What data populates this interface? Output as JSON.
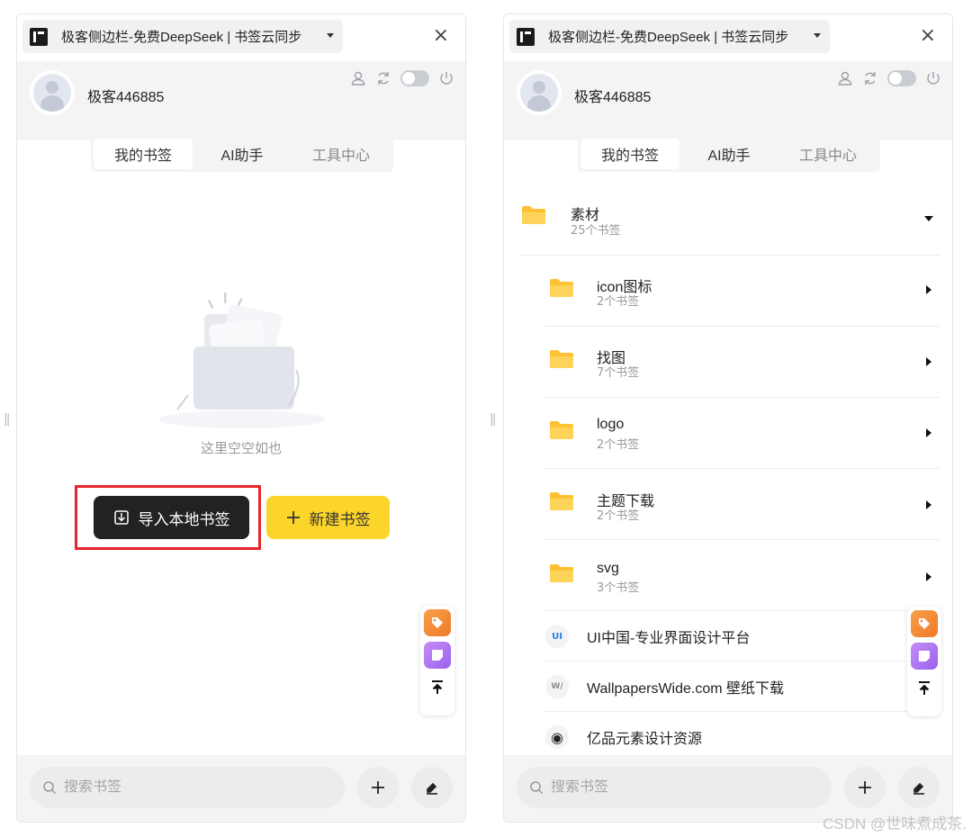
{
  "left_panel": {
    "tab_title": "极客侧边栏-免费DeepSeek | 书签云同步",
    "close_glyph": "×",
    "username": "极客446885",
    "segments": [
      {
        "label": "我的书签"
      },
      {
        "label": "AI助手"
      },
      {
        "label": "工具中心"
      }
    ],
    "empty_text": "这里空空如也",
    "import_label": "导入本地书签",
    "new_label": "新建书签",
    "search_placeholder": "搜索书签",
    "icons": [
      "user-icon",
      "sync-icon",
      "theme-toggle",
      "power-icon",
      "tag-icon",
      "note-icon",
      "back-to-top-icon",
      "plus-icon",
      "edit-icon",
      "search-icon"
    ]
  },
  "right_panel": {
    "tab_title": "极客侧边栏-免费DeepSeek | 书签云同步",
    "close_glyph": "×",
    "username": "极客446885",
    "segments": [
      {
        "label": "我的书签"
      },
      {
        "label": "AI助手"
      },
      {
        "label": "工具中心"
      }
    ],
    "root_folder": {
      "name": "素材",
      "count": "25个书签"
    },
    "subfolders": [
      {
        "name": "icon图标",
        "count": "2个书签"
      },
      {
        "name": "找图",
        "count": "7个书签"
      },
      {
        "name": "logo",
        "count": "2个书签"
      },
      {
        "name": "主题下载",
        "count": "2个书签"
      },
      {
        "name": "svg",
        "count": "3个书签"
      }
    ],
    "sites": [
      {
        "label": "UI中国-专业界面设计平台",
        "icon_text": "UI"
      },
      {
        "label": "WallpapersWide.com 壁纸下载",
        "icon_text": "W/"
      },
      {
        "label": "亿品元素设计资源",
        "icon_text": "◉"
      }
    ],
    "search_placeholder": "搜索书签"
  },
  "split_handle": "||",
  "watermark": "CSDN @世味煮成茶.",
  "colors": {
    "folder": "#fcc233",
    "import_btn": "#222222",
    "new_btn": "#fcd52a",
    "highlight": "#e5262a",
    "tag_btn": "#f38a35",
    "note_btn": "#b077f1"
  }
}
